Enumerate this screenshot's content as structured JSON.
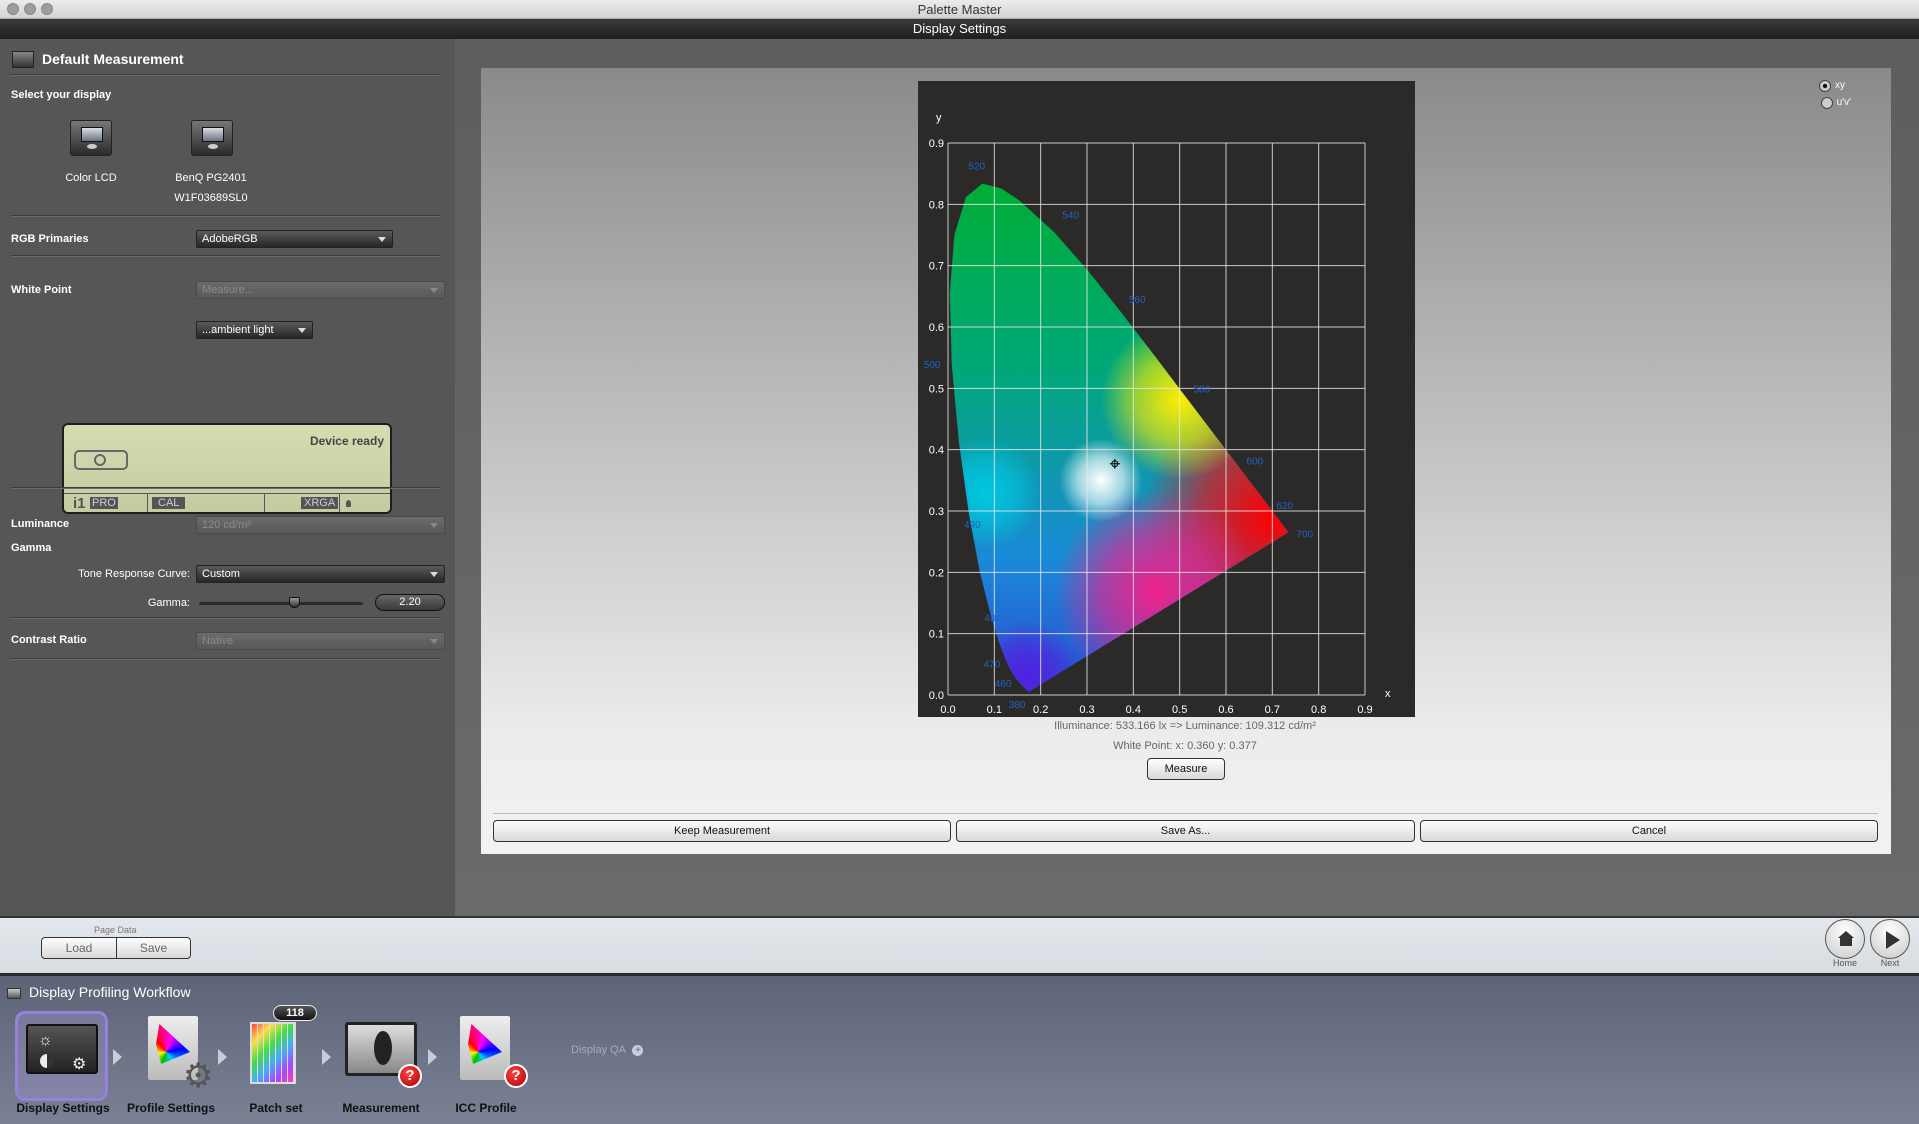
{
  "window": {
    "title": "Palette Master",
    "subtitle": "Display Settings"
  },
  "left_panel": {
    "header": "Default Measurement",
    "select_display_label": "Select your display",
    "displays": [
      {
        "name": "Color LCD",
        "serial": ""
      },
      {
        "name": "BenQ PG2401",
        "serial": "W1F03689SL0"
      }
    ],
    "rgb_primaries": {
      "label": "RGB Primaries",
      "value": "AdobeRGB"
    },
    "white_point": {
      "label": "White Point",
      "value": "Measure...",
      "secondary_value": "...ambient light"
    },
    "device": {
      "status": "Device ready",
      "brand": "i1",
      "model": "PRO",
      "mode": "CAL",
      "standard": "XRGA"
    },
    "luminance": {
      "label": "Luminance",
      "value": "120 cd/m²"
    },
    "gamma": {
      "section_label": "Gamma",
      "trc_label": "Tone Response Curve:",
      "trc_value": "Custom",
      "gamma_label": "Gamma:",
      "gamma_value": "2.20",
      "slider_fraction": 0.58
    },
    "contrast_ratio": {
      "label": "Contrast Ratio",
      "value": "Native"
    }
  },
  "chart_mode": {
    "options": [
      "xy",
      "u'v'"
    ],
    "selected": "xy"
  },
  "chart_data": {
    "type": "scatter",
    "title": "",
    "xlabel": "x",
    "ylabel": "y",
    "xlim": [
      0.0,
      0.9
    ],
    "ylim": [
      0.0,
      0.9
    ],
    "x_ticks": [
      "0.0",
      "0.1",
      "0.2",
      "0.3",
      "0.4",
      "0.5",
      "0.6",
      "0.7",
      "0.8",
      "0.9"
    ],
    "y_ticks": [
      "0.0",
      "0.1",
      "0.2",
      "0.3",
      "0.4",
      "0.5",
      "0.6",
      "0.7",
      "0.8",
      "0.9"
    ],
    "grid": true,
    "wavelength_labels": [
      {
        "nm": "520",
        "x": 0.0743,
        "y": 0.8338
      },
      {
        "nm": "540",
        "x": 0.2296,
        "y": 0.7543
      },
      {
        "nm": "560",
        "x": 0.3731,
        "y": 0.6245
      },
      {
        "nm": "580",
        "x": 0.5125,
        "y": 0.4866
      },
      {
        "nm": "600",
        "x": 0.627,
        "y": 0.3725
      },
      {
        "nm": "620",
        "x": 0.6915,
        "y": 0.3083
      },
      {
        "nm": "700",
        "x": 0.7347,
        "y": 0.2653
      },
      {
        "nm": "500",
        "x": 0.0082,
        "y": 0.5384
      },
      {
        "nm": "490",
        "x": 0.0454,
        "y": 0.295
      },
      {
        "nm": "480",
        "x": 0.0913,
        "y": 0.1327
      },
      {
        "nm": "470",
        "x": 0.1241,
        "y": 0.0578
      },
      {
        "nm": "460",
        "x": 0.144,
        "y": 0.0297
      },
      {
        "nm": "380",
        "x": 0.1741,
        "y": 0.005
      }
    ],
    "white_point": {
      "x": 0.36,
      "y": 0.377
    },
    "label_color": "#1e64c8"
  },
  "readout": {
    "illuminance": "Illuminance:  533.166 lx  =>  Luminance:  109.312 cd/m²",
    "white_point": "White Point: x: 0.360  y: 0.377"
  },
  "buttons": {
    "measure": "Measure",
    "keep": "Keep Measurement",
    "save_as": "Save As...",
    "cancel": "Cancel"
  },
  "page_data": {
    "label": "Page Data",
    "load": "Load",
    "save": "Save"
  },
  "nav": {
    "home": "Home",
    "next": "Next"
  },
  "workflow": {
    "title": "Display Profiling Workflow",
    "steps": [
      {
        "label": "Display Settings",
        "active": true
      },
      {
        "label": "Profile Settings"
      },
      {
        "label": "Patch set",
        "badge": "118"
      },
      {
        "label": "Measurement",
        "warning": true
      },
      {
        "label": "ICC Profile",
        "warning": true
      }
    ],
    "extra": "Display QA",
    "active_color": "#9b7fe0"
  }
}
